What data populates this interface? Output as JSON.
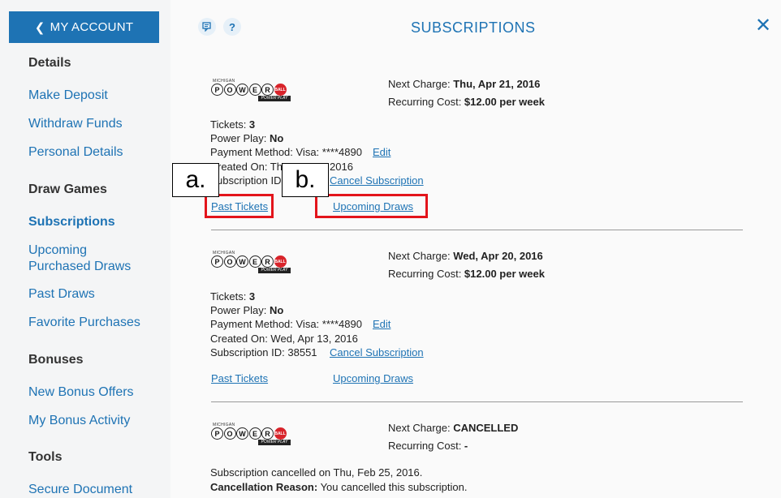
{
  "sidebar": {
    "back_label": "MY ACCOUNT",
    "sections": {
      "details": "Details",
      "draw_games": "Draw Games",
      "bonuses": "Bonuses",
      "tools": "Tools"
    },
    "links": {
      "make_deposit": "Make Deposit",
      "withdraw_funds": "Withdraw Funds",
      "personal_details": "Personal Details",
      "subscriptions": "Subscriptions",
      "upcoming_1": "Upcoming",
      "upcoming_2": "Purchased Draws",
      "past_draws": "Past Draws",
      "favorite_purchases": "Favorite Purchases",
      "new_bonus_offers": "New Bonus Offers",
      "my_bonus_activity": "My Bonus Activity",
      "secure_document": "Secure Document"
    }
  },
  "header": {
    "title": "SUBSCRIPTIONS",
    "help_glyph": "?",
    "close_glyph": "✕"
  },
  "logo": {
    "michigan": "MICHIGAN",
    "letters": [
      "P",
      "O",
      "W",
      "E",
      "R"
    ],
    "ball": "BALL",
    "powerplay": "POWER PLAY"
  },
  "subscriptions": [
    {
      "next_charge_label": "Next Charge: ",
      "next_charge": "Thu, Apr 21, 2016",
      "recurring_label": "Recurring Cost: ",
      "recurring": "$12.00 per week",
      "tickets_label": "Tickets: ",
      "tickets": "3",
      "powerplay_label": "Power Play: ",
      "powerplay": "No",
      "payment": "Payment Method: Visa: ****4890",
      "edit": "Edit",
      "created_visible": "reated On: Th",
      "created_year": "2016",
      "subid_visible": "ubscription ID",
      "cancel": "Cancel Subscription",
      "past_tickets": "Past Tickets",
      "upcoming_draws": "Upcoming Draws"
    },
    {
      "next_charge_label": "Next Charge: ",
      "next_charge": "Wed, Apr 20, 2016",
      "recurring_label": "Recurring Cost: ",
      "recurring": "$12.00 per week",
      "tickets_label": "Tickets: ",
      "tickets": "3",
      "powerplay_label": "Power Play: ",
      "powerplay": "No",
      "payment": "Payment Method: Visa: ****4890",
      "edit": "Edit",
      "created": "Created On: Wed, Apr 13, 2016",
      "subid": "Subscription ID: 38551",
      "cancel": "Cancel Subscription",
      "past_tickets": "Past Tickets",
      "upcoming_draws": "Upcoming Draws"
    },
    {
      "next_charge_label": "Next Charge: ",
      "next_charge": "CANCELLED",
      "recurring_label": "Recurring Cost: ",
      "recurring": "-",
      "cancelled_on": "Subscription cancelled on Thu, Feb 25, 2016.",
      "reason_label": "Cancellation Reason:",
      "reason": " You cancelled this subscription."
    }
  ],
  "callouts": {
    "a": "a.",
    "b": "b."
  },
  "colors": {
    "accent": "#1e73b4",
    "highlight": "#e3141b"
  }
}
